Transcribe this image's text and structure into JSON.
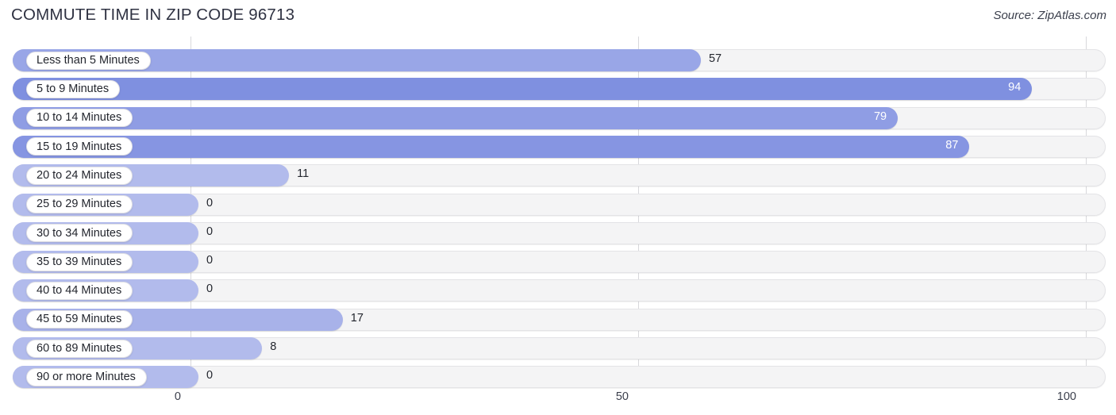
{
  "header": {
    "title": "COMMUTE TIME IN ZIP CODE 96713",
    "source": "Source: ZipAtlas.com"
  },
  "axis": {
    "ticks": [
      {
        "label": "0",
        "value": 0
      },
      {
        "label": "50",
        "value": 50
      },
      {
        "label": "100",
        "value": 100
      }
    ]
  },
  "colors": {
    "bar_light": "#b2bbec",
    "bar_mid": "#99a6e7",
    "bar_strong": "#7f90e0",
    "track": "#f4f4f5",
    "track_border": "#e3e3e6",
    "gridline": "#d8d8dc",
    "text": "#23262e",
    "value_inside": "#ffffff",
    "title": "#2f3242"
  },
  "chart_data": {
    "type": "bar",
    "orientation": "horizontal",
    "title": "COMMUTE TIME IN ZIP CODE 96713",
    "xlabel": "",
    "ylabel": "",
    "xlim": [
      0,
      100
    ],
    "grid": true,
    "legend": false,
    "source": "Source: ZipAtlas.com",
    "categories": [
      "Less than 5 Minutes",
      "5 to 9 Minutes",
      "10 to 14 Minutes",
      "15 to 19 Minutes",
      "20 to 24 Minutes",
      "25 to 29 Minutes",
      "30 to 34 Minutes",
      "35 to 39 Minutes",
      "40 to 44 Minutes",
      "45 to 59 Minutes",
      "60 to 89 Minutes",
      "90 or more Minutes"
    ],
    "values": [
      57,
      94,
      79,
      87,
      11,
      0,
      0,
      0,
      0,
      17,
      8,
      0
    ],
    "value_labels": [
      "57",
      "94",
      "79",
      "87",
      "11",
      "0",
      "0",
      "0",
      "0",
      "17",
      "8",
      "0"
    ]
  },
  "rows": [
    {
      "label": "Less than 5 Minutes",
      "value": 57,
      "value_label": "57",
      "color": "#99a6e7",
      "inside": false
    },
    {
      "label": "5 to 9 Minutes",
      "value": 94,
      "value_label": "94",
      "color": "#7f90e0",
      "inside": true
    },
    {
      "label": "10 to 14 Minutes",
      "value": 79,
      "value_label": "79",
      "color": "#8f9de4",
      "inside": true
    },
    {
      "label": "15 to 19 Minutes",
      "value": 87,
      "value_label": "87",
      "color": "#8695e2",
      "inside": true
    },
    {
      "label": "20 to 24 Minutes",
      "value": 11,
      "value_label": "11",
      "color": "#b2bbec",
      "inside": false
    },
    {
      "label": "25 to 29 Minutes",
      "value": 0,
      "value_label": "0",
      "color": "#b2bbec",
      "inside": false
    },
    {
      "label": "30 to 34 Minutes",
      "value": 0,
      "value_label": "0",
      "color": "#b2bbec",
      "inside": false
    },
    {
      "label": "35 to 39 Minutes",
      "value": 0,
      "value_label": "0",
      "color": "#b2bbec",
      "inside": false
    },
    {
      "label": "40 to 44 Minutes",
      "value": 0,
      "value_label": "0",
      "color": "#b2bbec",
      "inside": false
    },
    {
      "label": "45 to 59 Minutes",
      "value": 17,
      "value_label": "17",
      "color": "#a8b2e9",
      "inside": false
    },
    {
      "label": "60 to 89 Minutes",
      "value": 8,
      "value_label": "8",
      "color": "#b2bbec",
      "inside": false
    },
    {
      "label": "90 or more Minutes",
      "value": 0,
      "value_label": "0",
      "color": "#b2bbec",
      "inside": false
    }
  ]
}
